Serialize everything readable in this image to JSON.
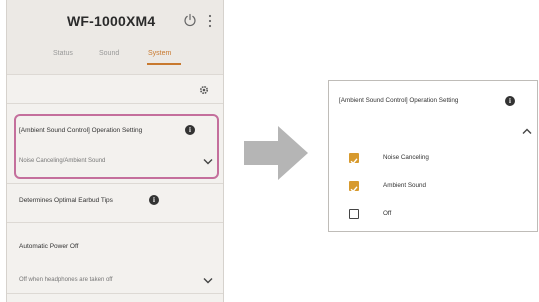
{
  "app": {
    "device_name": "WF-1000XM4"
  },
  "tabs": [
    {
      "label": "Status",
      "active": false
    },
    {
      "label": "Sound",
      "active": false
    },
    {
      "label": "System",
      "active": true
    }
  ],
  "settings": {
    "ambient": {
      "title": "[Ambient Sound Control] Operation Setting",
      "value": "Noise Canceling/Ambient Sound"
    },
    "eartips": {
      "title": "Determines Optimal Earbud Tips"
    },
    "power_off": {
      "title": "Automatic Power Off",
      "value": "Off when headphones are taken off"
    }
  },
  "panel": {
    "title": "[Ambient Sound Control] Operation Setting",
    "options": [
      {
        "label": "Noise Canceling",
        "checked": true
      },
      {
        "label": "Ambient Sound",
        "checked": true
      },
      {
        "label": "Off",
        "checked": false
      }
    ]
  },
  "colors": {
    "accent": "#c8792f",
    "highlight": "#c46f9c",
    "checkbox_on": "#d79a2e",
    "arrow": "#b5b5b5"
  },
  "icons": {
    "power": "power-icon",
    "menu": "more-vert-icon",
    "gear": "gear-icon",
    "info": "info-icon",
    "chevron_down": "chevron-down-icon",
    "chevron_up": "chevron-up-icon",
    "arrow": "arrow-right-icon"
  }
}
